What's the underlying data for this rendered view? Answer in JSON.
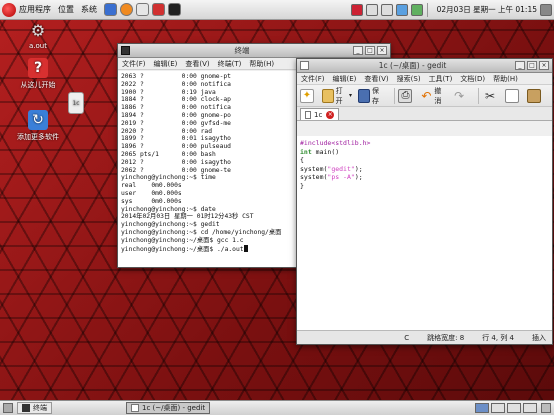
{
  "top_panel": {
    "menu_apps": "应用程序",
    "menu_places": "位置",
    "menu_system": "系统",
    "clock": "02月03日 星期一 上午 01:15"
  },
  "desktop": {
    "icons": [
      {
        "label": "a.out"
      },
      {
        "label": "从这儿开始"
      },
      {
        "label": "添加更多软件"
      },
      {
        "label": "1c"
      }
    ]
  },
  "terminal": {
    "title": "终端",
    "menu": [
      "文件(F)",
      "编辑(E)",
      "查看(V)",
      "终端(T)",
      "帮助(H)"
    ],
    "lines": [
      "2063 ?          0:00 gnome-pt",
      "2022 ?          0:00 notifica",
      "1900 ?          0:19 java",
      "1884 ?          0:00 clock-ap",
      "1886 ?          0:00 notifica",
      "1894 ?          0:00 gnome-po",
      "2019 ?          0:00 gvfsd-me",
      "2020 ?          0:00 rad",
      "1899 ?          0:01 isagytho",
      "1896 ?          0:00 pulseaud",
      "2065 pts/1      0:00 bash",
      "2012 ?          0:00 isagytho",
      "2062 ?          0:00 gnome-te",
      "yinchong@yinchong:~$ time",
      "",
      "real    0m0.000s",
      "user    0m0.000s",
      "sys     0m0.000s",
      "yinchong@yinchong:~$ date",
      "2014年02月03日 星期一 01时12分43秒 CST",
      "yinchong@yinchong:~$ gedit",
      "yinchong@yinchong:~$ cd /home/yinchong/桌面",
      "yinchong@yinchong:~/桌面$ gcc 1.c",
      "yinchong@yinchong:~/桌面$ ./a.out"
    ]
  },
  "gedit": {
    "title": "1c (~/桌面) - gedit",
    "menu": [
      "文件(F)",
      "编辑(E)",
      "查看(V)",
      "搜索(S)",
      "工具(T)",
      "文档(D)",
      "帮助(H)"
    ],
    "toolbar": {
      "open_label": "打开",
      "save_label": "保存",
      "undo_label": "撤消"
    },
    "tab_label": "1c",
    "code": {
      "line1_pre": "#include",
      "line1_hdr": "<stdlib.h>",
      "line2": "",
      "line3_type": "int",
      "line3_rest": " main()",
      "line4": "{",
      "line5_fn": "system(",
      "line5_str": "\"gedit\"",
      "line5_end": ");",
      "line6_fn": "system(",
      "line6_str": "\"ps -A\"",
      "line6_end": ");",
      "line7": "",
      "line8": "}"
    },
    "status": {
      "lang": "C",
      "tab_width": "跳格宽度: 8",
      "position": "行 4, 列 4",
      "mode": "插入"
    }
  },
  "bottom_panel": {
    "task_terminal": "终端",
    "task_gedit": "1c (~/桌面) - gedit"
  }
}
